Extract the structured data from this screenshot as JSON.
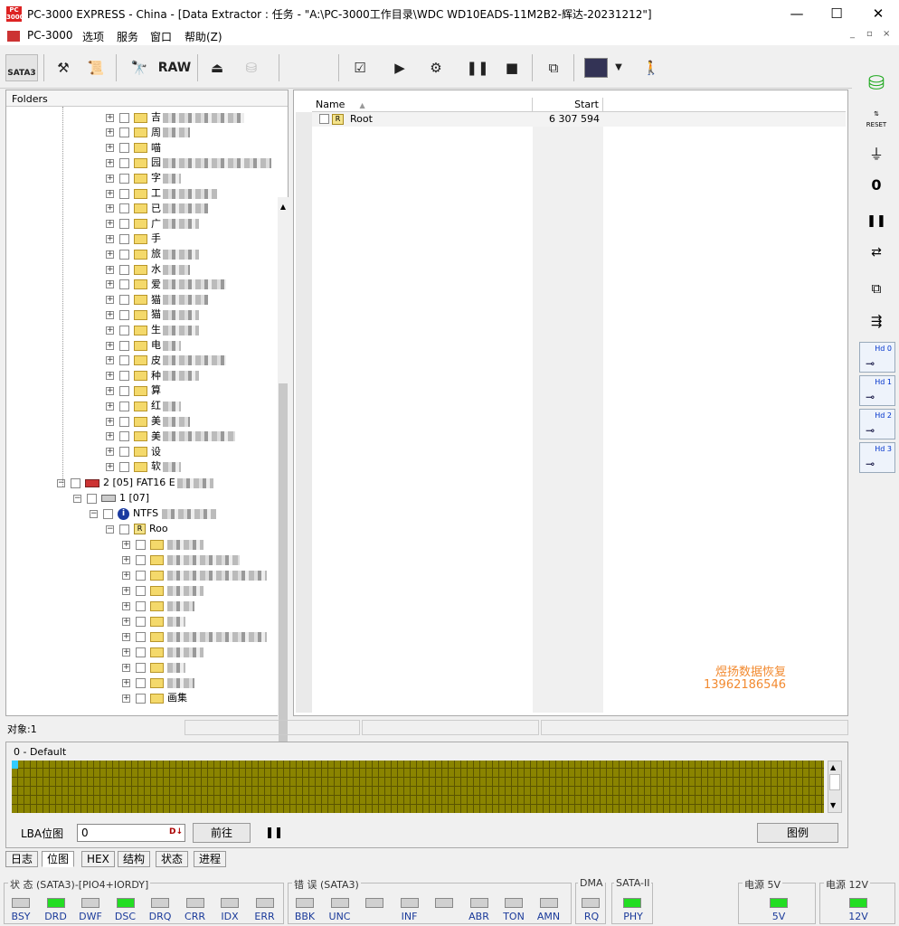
{
  "app": {
    "title": "PC-3000 EXPRESS - China - [Data Extractor : 任务 - \"A:\\PC-3000工作目录\\WDC WD10EADS-11M2B2-辉达-20231212\"]",
    "logo_text": "PC 3000"
  },
  "menu": [
    "PC-3000",
    "选项",
    "服务",
    "窗口",
    "帮助(Z)"
  ],
  "toolbar": {
    "sata_label": "SATA3",
    "raw_label": "RAW"
  },
  "right_toolbar": {
    "reset_label": "RESET",
    "zero_label": "0",
    "heads": [
      "Hd 0",
      "Hd 1",
      "Hd 2",
      "Hd 3"
    ]
  },
  "tree": {
    "header": "Folders",
    "upper_folders": [
      "吉",
      "周",
      "喵",
      "园",
      "字",
      "工",
      "已",
      "广",
      "手",
      "旅",
      "水",
      "爱",
      "猫",
      "猫",
      "生",
      "电",
      "皮",
      "种",
      "算",
      "红",
      "美",
      "美",
      "设",
      "软"
    ],
    "partition_label": "2 [05] FAT16 E",
    "volume_label": "1 [07]",
    "ntfs_label": "NTFS",
    "root_label": "Roo",
    "lower_folder_count": 11,
    "last_folder": "画集"
  },
  "list": {
    "col_name": "Name",
    "col_start": "Start",
    "rows": [
      {
        "name": "Root",
        "start": "6 307 594"
      }
    ],
    "watermark_line1": "煜扬数据恢复",
    "watermark_line2": "13962186546"
  },
  "status": {
    "objects": "对象:1"
  },
  "map": {
    "group_label": "0 - Default",
    "lba_label": "LBA位图",
    "lba_value": "0",
    "go_button": "前往",
    "legend_button": "图例"
  },
  "tabs": [
    "日志",
    "位图",
    "HEX",
    "结构",
    "状态",
    "进程"
  ],
  "indicators": {
    "status_group": "状 态 (SATA3)-[PIO4+IORDY]",
    "status_leds": [
      {
        "label": "BSY",
        "on": false
      },
      {
        "label": "DRD",
        "on": true
      },
      {
        "label": "DWF",
        "on": false
      },
      {
        "label": "DSC",
        "on": true
      },
      {
        "label": "DRQ",
        "on": false
      },
      {
        "label": "CRR",
        "on": false
      },
      {
        "label": "IDX",
        "on": false
      },
      {
        "label": "ERR",
        "on": false
      }
    ],
    "error_group": "错 误 (SATA3)",
    "error_leds": [
      {
        "label": "BBK",
        "on": false
      },
      {
        "label": "UNC",
        "on": false
      },
      {
        "label": "",
        "on": false
      },
      {
        "label": "INF",
        "on": false
      },
      {
        "label": "",
        "on": false
      },
      {
        "label": "ABR",
        "on": false
      },
      {
        "label": "TON",
        "on": false
      },
      {
        "label": "AMN",
        "on": false
      }
    ],
    "dma_group": "DMA",
    "dma_led": {
      "label": "RQ",
      "on": false
    },
    "sata_group": "SATA-II",
    "sata_led": {
      "label": "PHY",
      "on": true
    },
    "power5_group": "电源 5V",
    "power5_led": {
      "label": "5V",
      "on": true
    },
    "power12_group": "电源 12V",
    "power12_led": {
      "label": "12V",
      "on": true
    }
  }
}
